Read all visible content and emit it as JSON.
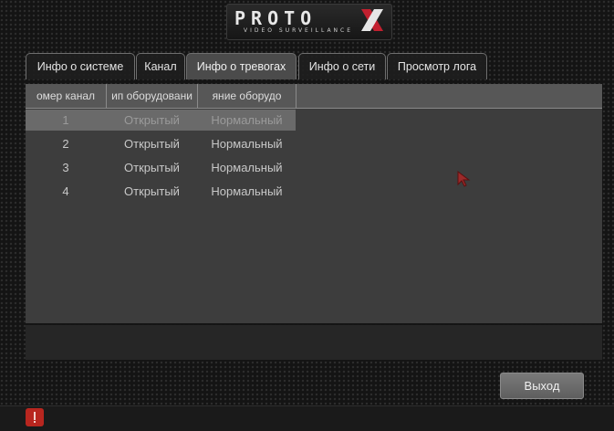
{
  "brand": {
    "logo_text": "PROTO",
    "logo_sub": "VIDEO SURVEILLANCE"
  },
  "tabs": [
    {
      "label": "Инфо о системе"
    },
    {
      "label": "Канал"
    },
    {
      "label": "Инфо о тревогах"
    },
    {
      "label": "Инфо о сети"
    },
    {
      "label": "Просмотр лога"
    }
  ],
  "active_tab": "Инфо о тревогах",
  "table": {
    "columns": [
      "омер канал",
      "ип оборудовани",
      "яние оборудо"
    ],
    "rows": [
      {
        "num": "1",
        "type": "Открытый",
        "state": "Нормальный"
      },
      {
        "num": "2",
        "type": "Открытый",
        "state": "Нормальный"
      },
      {
        "num": "3",
        "type": "Открытый",
        "state": "Нормальный"
      },
      {
        "num": "4",
        "type": "Открытый",
        "state": "Нормальный"
      }
    ]
  },
  "buttons": {
    "exit_label": "Выход"
  },
  "colors": {
    "accent_logo": "#c2202f",
    "alarm": "#b8261f"
  },
  "icons": {
    "alarm": "alarm-icon",
    "cursor": "mouse-cursor-icon"
  }
}
